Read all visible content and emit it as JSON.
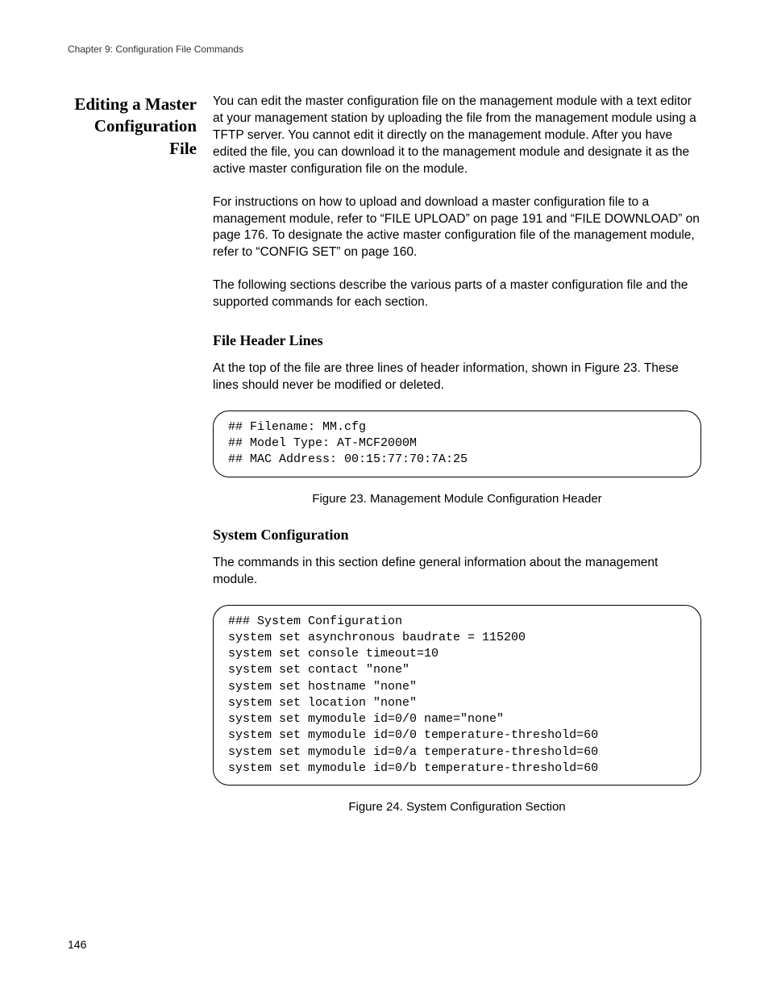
{
  "header": {
    "chapter": "Chapter 9: Configuration File Commands"
  },
  "sectionTitle": "Editing a Master Configuration File",
  "para1": "You can edit the master configuration file on the management module with a text editor at your management station by uploading the file from the management module using a TFTP server. You cannot edit it directly on the management module. After you have edited the file, you can download it to the management module and designate it as the active master configuration file on the module.",
  "para2": "For instructions on how to upload and download a master configuration file to a management module, refer to “FILE UPLOAD” on page 191 and “FILE DOWNLOAD” on page 176. To designate the active master configuration file of the management module, refer to “CONFIG SET” on page 160.",
  "para3": "The following sections describe the various parts of a master configuration file and the supported commands for each section.",
  "sub1": {
    "heading": "File Header Lines",
    "intro": "At the top of the file are three lines of header information, shown in Figure 23. These lines should never be modified or deleted.",
    "code": "## Filename: MM.cfg\n## Model Type: AT-MCF2000M\n## MAC Address: 00:15:77:70:7A:25",
    "caption": "Figure 23. Management Module Configuration Header"
  },
  "sub2": {
    "heading": "System Configuration",
    "intro": "The commands in this section define general information about the management module.",
    "code": "### System Configuration\nsystem set asynchronous baudrate = 115200\nsystem set console timeout=10\nsystem set contact \"none\"\nsystem set hostname \"none\"\nsystem set location \"none\"\nsystem set mymodule id=0/0 name=\"none\"\nsystem set mymodule id=0/0 temperature-threshold=60\nsystem set mymodule id=0/a temperature-threshold=60\nsystem set mymodule id=0/b temperature-threshold=60",
    "caption": "Figure 24. System Configuration Section"
  },
  "pageNumber": "146"
}
